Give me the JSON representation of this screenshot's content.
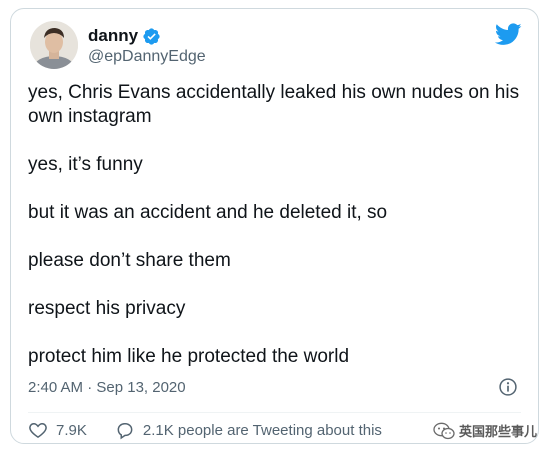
{
  "tweet": {
    "author": {
      "name": "danny",
      "handle": "@epDannyEdge",
      "verified": true
    },
    "lines": [
      "yes, Chris Evans accidentally leaked his own nudes on his own instagram",
      "yes, it’s funny",
      "but it was an accident and he deleted it, so",
      "please don’t share them",
      "respect his privacy",
      "protect him like he protected the world"
    ],
    "timestamp": "2:40 AM · Sep 13, 2020",
    "likes": "7.9K",
    "conversation": "2.1K people are Tweeting about this"
  },
  "icons": {
    "brand": "twitter-bird-icon",
    "verified": "verified-badge-icon",
    "info": "info-icon",
    "like": "heart-icon",
    "reply": "speech-bubble-icon"
  },
  "colors": {
    "twitter_blue": "#1d9bf0",
    "secondary_text": "#536471",
    "border": "#cfd9de"
  },
  "watermark": {
    "text": "英国那些事儿"
  }
}
